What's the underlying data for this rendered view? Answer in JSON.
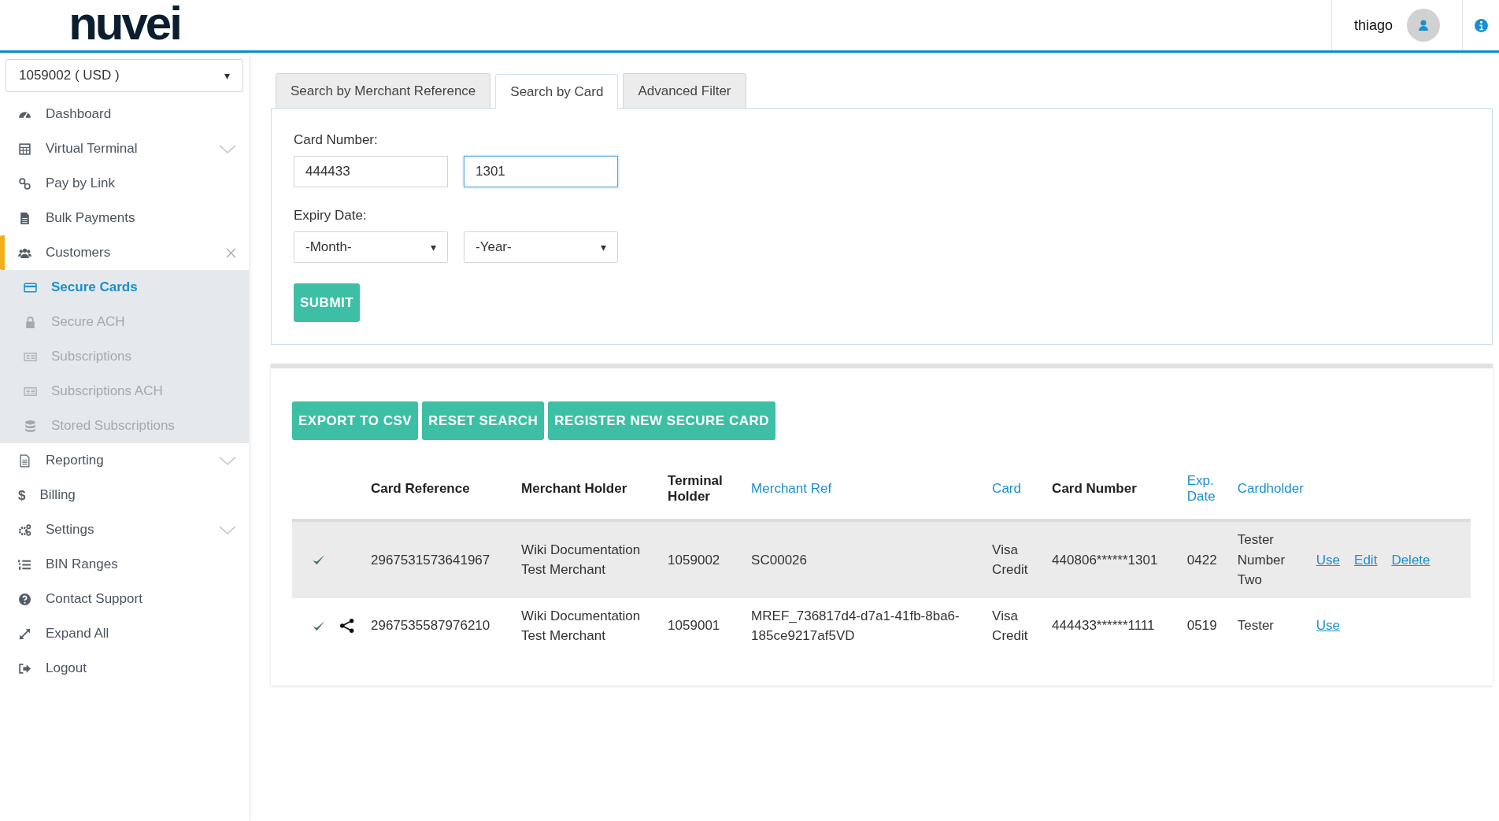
{
  "header": {
    "logo": "nuvei",
    "user": "thiago"
  },
  "sidebar": {
    "account": "1059002 ( USD )",
    "account_caret": "▾",
    "items": [
      {
        "label": "Dashboard",
        "selected": false
      },
      {
        "label": "Virtual Terminal",
        "selected": false,
        "expanded": false
      },
      {
        "label": "Pay by Link",
        "selected": false
      },
      {
        "label": "Bulk Payments",
        "selected": false
      },
      {
        "label": "Customers",
        "selected": true,
        "expanded": true,
        "children": [
          {
            "label": "Secure Cards",
            "selected": true
          },
          {
            "label": "Secure ACH",
            "selected": false
          },
          {
            "label": "Subscriptions",
            "selected": false
          },
          {
            "label": "Subscriptions ACH",
            "selected": false
          },
          {
            "label": "Stored Subscriptions",
            "selected": false
          }
        ]
      },
      {
        "label": "Reporting",
        "selected": false,
        "expanded": false
      },
      {
        "label": "Billing",
        "selected": false,
        "icon": "$"
      },
      {
        "label": "Settings",
        "selected": false,
        "expanded": false
      },
      {
        "label": "BIN Ranges",
        "selected": false
      },
      {
        "label": "Contact Support",
        "selected": false
      },
      {
        "label": "Expand All",
        "selected": false
      },
      {
        "label": "Logout",
        "selected": false
      }
    ]
  },
  "tabs": [
    {
      "label": "Search by Merchant Reference",
      "selected": false
    },
    {
      "label": "Search by Card",
      "selected": true
    },
    {
      "label": "Advanced Filter",
      "selected": false
    }
  ],
  "form": {
    "card_number_label": "Card Number:",
    "card_first": {
      "value": "444433",
      "focused": false
    },
    "card_last": {
      "value": "1301",
      "focused": true
    },
    "expiry_label": "Expiry Date:",
    "month": "-Month-",
    "year": "-Year-",
    "caret": "▾",
    "submit": "SUBMIT"
  },
  "actions": [
    "EXPORT TO CSV",
    "RESET SEARCH",
    "REGISTER NEW SECURE CARD"
  ],
  "table": {
    "columns": [
      {
        "label": "Card Reference",
        "sortable": false
      },
      {
        "label": "Merchant Holder",
        "sortable": false
      },
      {
        "label": "Terminal Holder",
        "sortable": false
      },
      {
        "label": "Merchant Ref",
        "sortable": true
      },
      {
        "label": "Card",
        "sortable": true
      },
      {
        "label": "Card Number",
        "sortable": false
      },
      {
        "label": "Exp. Date",
        "sortable": true
      },
      {
        "label": "Cardholder",
        "sortable": true
      }
    ],
    "rows": [
      {
        "highlighted": true,
        "verified": true,
        "shared": false,
        "card_reference": "2967531573641967",
        "merchant_holder": "Wiki Documentation Test Merchant",
        "terminal_holder": "1059002",
        "merchant_ref": "SC00026",
        "card": "Visa Credit",
        "card_number": "440806******1301",
        "exp_date": "0422",
        "cardholder": "Tester Number Two",
        "links": [
          "Use",
          "Edit",
          "Delete"
        ]
      },
      {
        "highlighted": false,
        "verified": true,
        "shared": true,
        "card_reference": "2967535587976210",
        "merchant_holder": "Wiki Documentation Test Merchant",
        "terminal_holder": "1059001",
        "merchant_ref": "MREF_736817d4-d7a1-41fb-8ba6-185ce9217af5VD",
        "card": "Visa Credit",
        "card_number": "444433******1111",
        "exp_date": "0519",
        "cardholder": "Tester",
        "links": [
          "Use"
        ]
      }
    ]
  }
}
